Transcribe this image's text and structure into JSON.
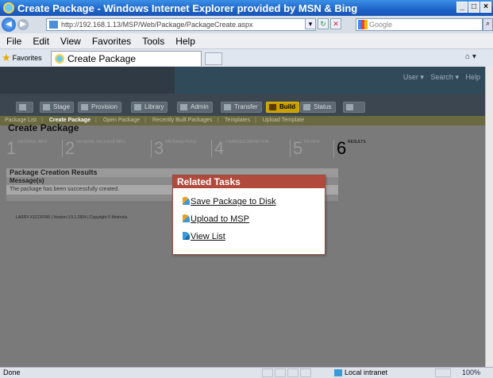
{
  "window": {
    "title": "Create Package - Windows Internet Explorer provided by MSN & Bing",
    "controls": [
      "_",
      "□",
      "×"
    ]
  },
  "address": {
    "url": "http://192.168.1.13/MSP/Web/Package/PackageCreate.aspx",
    "search_placeholder": "Google"
  },
  "menu": [
    "File",
    "Edit",
    "View",
    "Favorites",
    "Tools",
    "Help"
  ],
  "favorites": {
    "label": "Favorites",
    "tab_title": "Create Package"
  },
  "app": {
    "user_links": [
      "User ▾",
      "Search ▾",
      "Help"
    ],
    "nav_tabs": [
      {
        "label": "",
        "icon": "home-icon"
      },
      {
        "label": "Stage",
        "icon": "stage-icon"
      },
      {
        "label": "Provision",
        "icon": "provision-icon"
      },
      {
        "label": "Library",
        "icon": "library-icon"
      },
      {
        "label": "Admin",
        "icon": "admin-icon"
      },
      {
        "label": "Transfer",
        "icon": "transfer-icon"
      },
      {
        "label": "Build",
        "icon": "build-icon",
        "active": true
      },
      {
        "label": "Status",
        "icon": "status-icon"
      },
      {
        "label": "",
        "icon": "extra-icon"
      }
    ],
    "sub_nav": [
      "Package List",
      "Create Package",
      "Open Package",
      "Recently Built Packages",
      "Templates",
      "Upload Template"
    ],
    "page_title": "Create Package",
    "steps": [
      {
        "num": "1",
        "label": "PACKAGE INFO"
      },
      {
        "num": "2",
        "label": "GENERAL PACKAGE INFO"
      },
      {
        "num": "3",
        "label": "PACKAGE FILES"
      },
      {
        "num": "4",
        "label": "CHANGES DEFINITION"
      },
      {
        "num": "5",
        "label": "REVIEW"
      },
      {
        "num": "6",
        "label": "RESULTS"
      }
    ],
    "results": {
      "heading": "Package Creation Results",
      "sub_heading": "Message(s)",
      "message": "The package has been successfully created."
    },
    "footer": "LARRY-X1CCKF66 | Version 3.5.1.2904 | Copyright © Motorola"
  },
  "popup": {
    "title": "Related Tasks",
    "links": [
      "Save Package to Disk",
      "Upload to MSP",
      "View List"
    ]
  },
  "status": {
    "text": "Done",
    "zone": "Local intranet",
    "zoom": "100%"
  }
}
